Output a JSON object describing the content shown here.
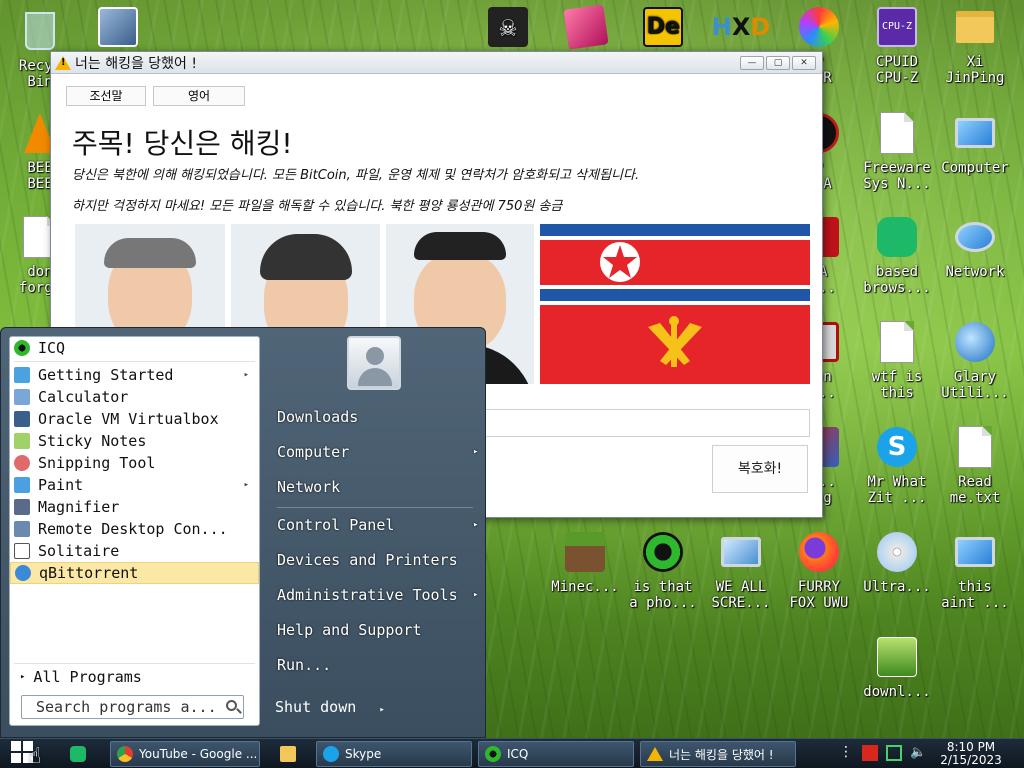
{
  "desktop": {
    "icons": [
      {
        "label": "Recyc\nBin"
      },
      {
        "label": ""
      },
      {
        "label": ""
      },
      {
        "label": ""
      },
      {
        "label": ""
      },
      {
        "label": ""
      },
      {
        "label": "P\nSER"
      },
      {
        "label": "CPUID\nCPU-Z"
      },
      {
        "label": "Xi\nJinPing"
      },
      {
        "label": "BEE\nBEE"
      },
      {
        "label": "P\nPIA"
      },
      {
        "label": "Freeware\nSys N..."
      },
      {
        "label": "Computer"
      },
      {
        "label": "don\nforge"
      },
      {
        "label": "YA\nD..."
      },
      {
        "label": "based\nbrows..."
      },
      {
        "label": "Network"
      },
      {
        "label": "dan\nc..."
      },
      {
        "label": "wtf is\nthis"
      },
      {
        "label": "Glary\nUtili..."
      },
      {
        "label": "n...\ning"
      },
      {
        "label": "Mr What\nZit ..."
      },
      {
        "label": "Read\nme.txt"
      },
      {
        "label": "Minec..."
      },
      {
        "label": "is that\na pho..."
      },
      {
        "label": "WE ALL\nSCRE..."
      },
      {
        "label": "FURRY\nFOX UWU"
      },
      {
        "label": "Ultra..."
      },
      {
        "label": "this\naint ..."
      },
      {
        "label": "downl..."
      }
    ]
  },
  "ransom_window": {
    "title": "너는 해킹을 당했어 !",
    "lang_buttons": [
      "조선말",
      "영어"
    ],
    "heading": "주목! 당신은 해킹!",
    "line1": "당신은 북한에 의해 해킹되었습니다. 모든 BitCoin, 파일, 운영 체제 및 연락처가 암호화되고 삭제됩니다.",
    "line2": "하지만 걱정하지 마세요! 모든 파일을 해독할 수 있습니다. 북한 평양 룡성관에 750원 송금",
    "decrypt_label": "복호화!",
    "input_value": ""
  },
  "start_menu": {
    "pinned": {
      "label": "ICQ"
    },
    "programs": [
      {
        "label": "Getting Started",
        "arrow": "▸"
      },
      {
        "label": "Calculator",
        "arrow": ""
      },
      {
        "label": "Oracle VM Virtualbox",
        "arrow": ""
      },
      {
        "label": "Sticky Notes",
        "arrow": ""
      },
      {
        "label": "Snipping Tool",
        "arrow": ""
      },
      {
        "label": "Paint",
        "arrow": "▸"
      },
      {
        "label": "Magnifier",
        "arrow": ""
      },
      {
        "label": "Remote Desktop Con...",
        "arrow": ""
      },
      {
        "label": "Solitaire",
        "arrow": ""
      },
      {
        "label": "qBittorrent",
        "arrow": ""
      }
    ],
    "all_programs": "All Programs",
    "search_placeholder": "Search programs a...",
    "right": [
      {
        "label": "Downloads",
        "arrow": ""
      },
      {
        "label": "Computer",
        "arrow": "▸"
      },
      {
        "label": "Network",
        "arrow": ""
      },
      {
        "label": "Control Panel",
        "arrow": "▸"
      },
      {
        "label": "Devices and Printers",
        "arrow": ""
      },
      {
        "label": "Administrative Tools",
        "arrow": "▸"
      },
      {
        "label": "Help and Support",
        "arrow": ""
      },
      {
        "label": "Run...",
        "arrow": ""
      }
    ],
    "shutdown_label": "Shut down",
    "shutdown_arrow": "▸"
  },
  "taskbar": {
    "buttons": [
      {
        "label": ""
      },
      {
        "label": "YouTube - Google ..."
      },
      {
        "label": ""
      },
      {
        "label": "Skype"
      },
      {
        "label": "ICQ"
      },
      {
        "label": "너는 해킹을 당했어 !"
      }
    ],
    "time": "8:10 PM",
    "date": "2/15/2023"
  },
  "colors": {
    "accent_selected": "#fbe8a6",
    "start_menu_bg": "#3a4e5f",
    "flag_red": "#e5252a",
    "flag_blue": "#1f56a8",
    "icq_green": "#2eb82e"
  }
}
